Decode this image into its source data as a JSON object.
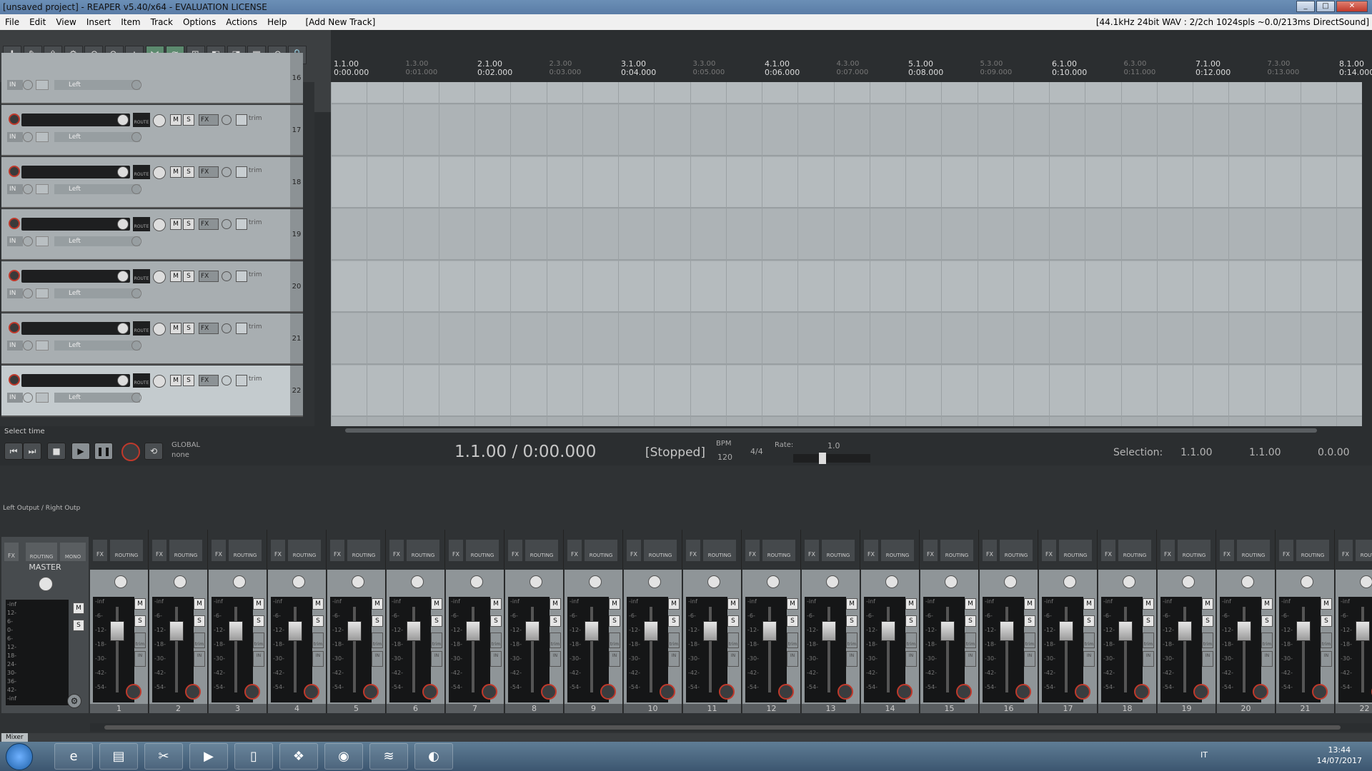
{
  "window": {
    "title": "[unsaved project] - REAPER v5.40/x64 - EVALUATION LICENSE",
    "buttons": [
      "_",
      "□",
      "✕"
    ]
  },
  "menu": {
    "items": [
      "File",
      "Edit",
      "View",
      "Insert",
      "Item",
      "Track",
      "Options",
      "Actions",
      "Help",
      "[Add New Track]"
    ],
    "audio_status": "[44.1kHz 24bit WAV : 2/2ch 1024spls ~0.0/213ms DirectSound]"
  },
  "toolbar": {
    "icons": [
      "new-project-icon",
      "open-project-icon",
      "save-project-icon",
      "project-settings-icon",
      "undo-icon",
      "redo-icon",
      "metronome-icon",
      "snap-icon",
      "ripple-edit-icon",
      "grouping-icon",
      "item-lock-icon",
      "envelope-lock-icon",
      "grid-icon",
      "loop-icon",
      "lock-icon"
    ],
    "glyphs": [
      "✚",
      "✎",
      "⇪",
      "⚙",
      "↶",
      "↷",
      "△",
      "⋈",
      "≋",
      "⊞",
      "◧",
      "◨",
      "▦",
      "⟲",
      "🔒"
    ]
  },
  "tracks": [
    {
      "number": "16",
      "input": "IN",
      "input_name": "Left"
    },
    {
      "number": "17",
      "input": "IN",
      "input_name": "Left"
    },
    {
      "number": "18",
      "input": "IN",
      "input_name": "Left"
    },
    {
      "number": "19",
      "input": "IN",
      "input_name": "Left"
    },
    {
      "number": "20",
      "input": "IN",
      "input_name": "Left"
    },
    {
      "number": "21",
      "input": "IN",
      "input_name": "Left"
    },
    {
      "number": "22",
      "input": "IN",
      "input_name": "Left"
    }
  ],
  "track_controls": {
    "mute": "M",
    "solo": "S",
    "fx": "FX",
    "trim": "trim",
    "route": "ROUTE"
  },
  "ruler": {
    "marks": [
      {
        "bar": "1.1.00",
        "time": "0:00.000",
        "minor": false
      },
      {
        "bar": "1.3.00",
        "time": "0:01.000",
        "minor": true
      },
      {
        "bar": "2.1.00",
        "time": "0:02.000",
        "minor": false
      },
      {
        "bar": "2.3.00",
        "time": "0:03.000",
        "minor": true
      },
      {
        "bar": "3.1.00",
        "time": "0:04.000",
        "minor": false
      },
      {
        "bar": "3.3.00",
        "time": "0:05.000",
        "minor": true
      },
      {
        "bar": "4.1.00",
        "time": "0:06.000",
        "minor": false
      },
      {
        "bar": "4.3.00",
        "time": "0:07.000",
        "minor": true
      },
      {
        "bar": "5.1.00",
        "time": "0:08.000",
        "minor": false
      },
      {
        "bar": "5.3.00",
        "time": "0:09.000",
        "minor": true
      },
      {
        "bar": "6.1.00",
        "time": "0:10.000",
        "minor": false
      },
      {
        "bar": "6.3.00",
        "time": "0:11.000",
        "minor": true
      },
      {
        "bar": "7.1.00",
        "time": "0:12.000",
        "minor": false
      },
      {
        "bar": "7.3.00",
        "time": "0:13.000",
        "minor": true
      },
      {
        "bar": "8.1.00",
        "time": "0:14.000",
        "minor": false
      }
    ]
  },
  "status": {
    "select_time": "Select time"
  },
  "transport": {
    "global_label": "GLOBAL",
    "global_value": "none",
    "position": "1.1.00 / 0:00.000",
    "state": "[Stopped]",
    "bpm_label": "BPM",
    "bpm": "120",
    "time_signature": "4/4",
    "rate_label": "Rate:",
    "rate": "1.0",
    "selection_label": "Selection:",
    "selection_start": "1.1.00",
    "selection_end": "1.1.00",
    "selection_length": "0.0.00",
    "buttons": [
      "⏮",
      "⏭",
      "■",
      "▶",
      "❚❚",
      "",
      "⟲"
    ]
  },
  "mixer": {
    "output": "Left Output / Right Outp",
    "master": {
      "name": "MASTER",
      "fx": "FX",
      "routing": "ROUTING",
      "mono": "MONO",
      "m": "M",
      "s": "S"
    },
    "strip_labels": {
      "fx": "FX",
      "routing": "ROUTING",
      "m": "M",
      "s": "S",
      "trim": "trim",
      "in": "IN"
    },
    "scale": [
      "-inf",
      "-6-",
      "-12-",
      "-18-",
      "-30-",
      "-42-",
      "-54-"
    ],
    "master_scale": [
      "-inf",
      "12-",
      "6-",
      "0-",
      "6-",
      "12-",
      "18-",
      "24-",
      "30-",
      "36-",
      "42-",
      "-inf"
    ],
    "strips": [
      "1",
      "2",
      "3",
      "4",
      "5",
      "6",
      "7",
      "8",
      "9",
      "10",
      "11",
      "12",
      "13",
      "14",
      "15",
      "16",
      "17",
      "18",
      "19",
      "20",
      "21",
      "22"
    ],
    "tab": "Mixer"
  },
  "taskbar": {
    "apps": [
      {
        "name": "internet-explorer-icon",
        "glyph": "e"
      },
      {
        "name": "file-explorer-icon",
        "glyph": "▤"
      },
      {
        "name": "tools-icon",
        "glyph": "✂"
      },
      {
        "name": "media-player-icon",
        "glyph": "▶"
      },
      {
        "name": "document-icon",
        "glyph": "▯"
      },
      {
        "name": "dropbox-icon",
        "glyph": "❖"
      },
      {
        "name": "chrome-icon",
        "glyph": "◉"
      },
      {
        "name": "spotify-icon",
        "glyph": "≋"
      },
      {
        "name": "reaper-icon",
        "glyph": "◐"
      }
    ],
    "language": "IT",
    "time": "13:44",
    "date": "14/07/2017"
  }
}
